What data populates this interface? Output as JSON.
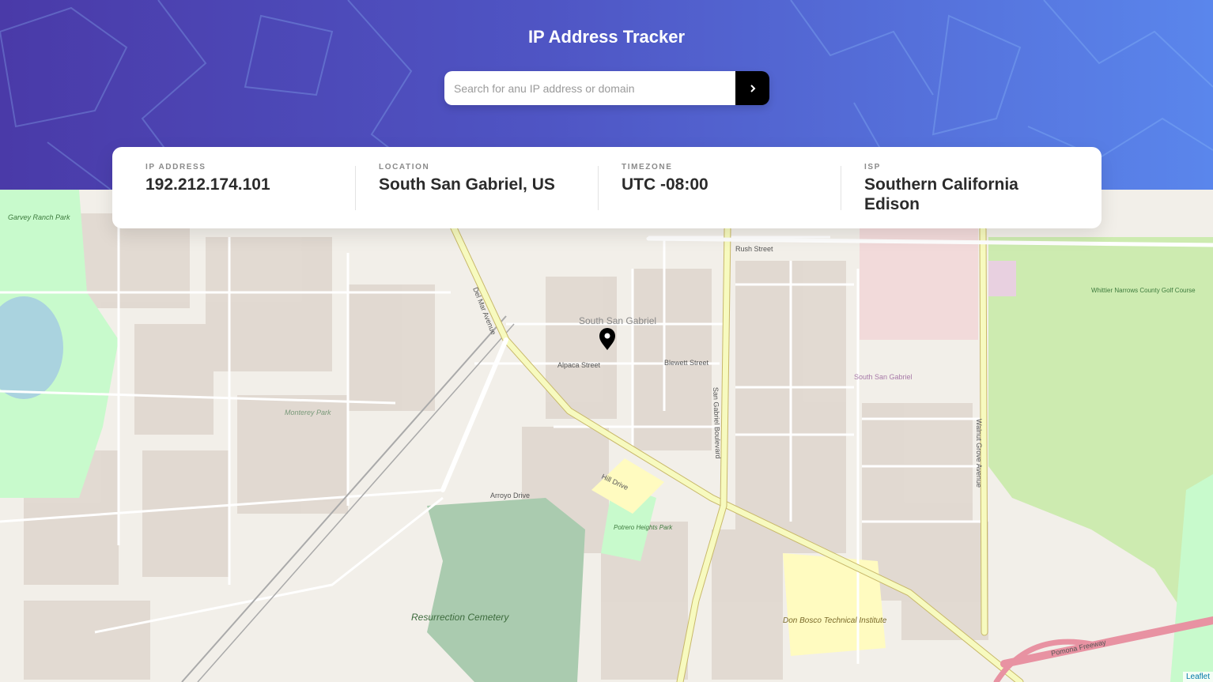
{
  "header": {
    "title": "IP Address Tracker",
    "search_placeholder": "Search for anu IP address or domain",
    "submit_icon": "chevron-right-icon"
  },
  "info": {
    "ip": {
      "label": "IP ADDRESS",
      "value": "192.212.174.101"
    },
    "location": {
      "label": "LOCATION",
      "value": "South San Gabriel, US"
    },
    "timezone": {
      "label": "TIMEZONE",
      "value": "UTC -08:00"
    },
    "isp": {
      "label": "ISP",
      "value": "Southern California Edison"
    }
  },
  "map": {
    "marker_icon": "location-pin-icon",
    "attribution": "Leaflet",
    "labels": {
      "area": "South San Gabriel",
      "cemetery": "Resurrection Cemetery",
      "school": "Don Bosco Technical Institute",
      "park1": "Garvey Ranch Park",
      "park2": "Potrero Heights Park",
      "golf": "Whittier Narrows County Golf Course",
      "rush": "Rush Street",
      "hill": "Hill Drive",
      "sgb": "San Gabriel Boulevard",
      "walnut": "Walnut Grove Avenue",
      "delmar": "Del Mar Avenue",
      "alpaca": "Alpaca Street",
      "blewett": "Blewett Street",
      "arroyo": "Arroyo Drive",
      "pomona": "Pomona Freeway",
      "montereypark": "Monterey Park",
      "southsg": "South San Gabriel"
    }
  },
  "colors": {
    "header_start": "#4a3aa8",
    "header_end": "#5a86ec",
    "button": "#000000",
    "park": "#c8facc",
    "cemetery": "#aacbaf",
    "major_road": "#f7fabf"
  }
}
